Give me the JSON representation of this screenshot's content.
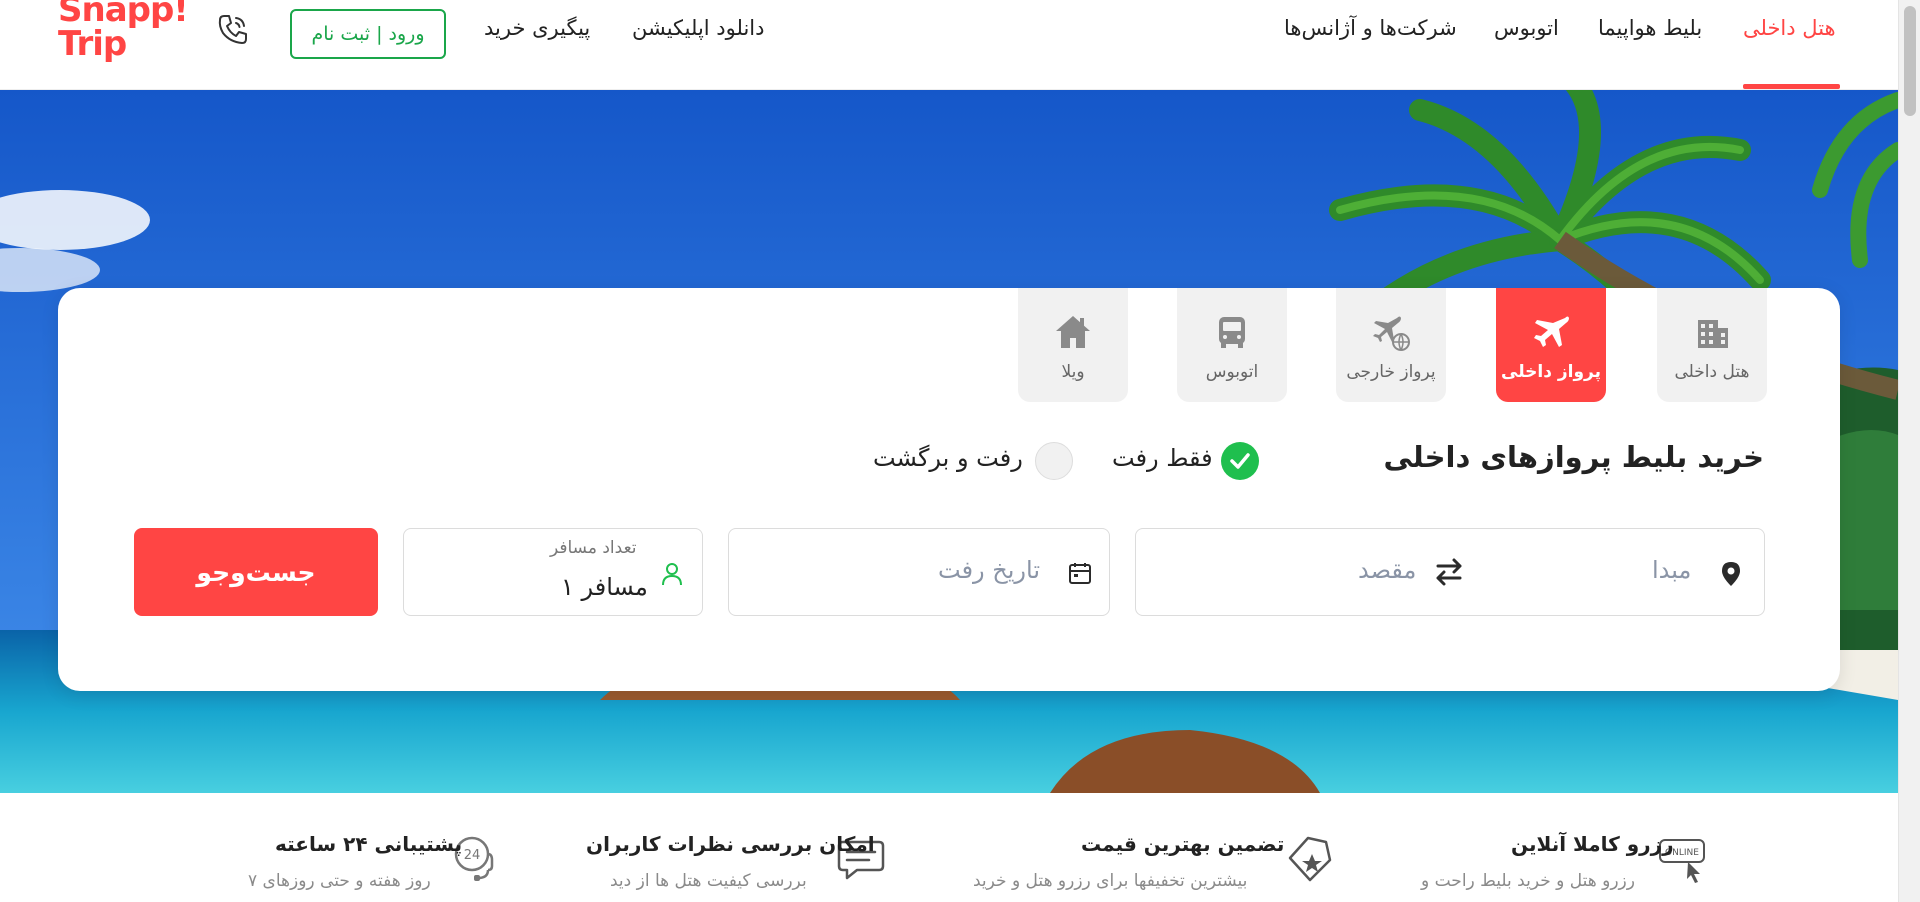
{
  "brand": {
    "logo_line1": "Snapp!",
    "logo_line2": "Trip",
    "accent_color": "#ff4544",
    "green_color": "#1aa64a"
  },
  "header": {
    "login_label": "ورود | ثبت نام",
    "phone_icon": "phone-icon",
    "nav": {
      "hotel": "هتل داخلی",
      "flight": "بلیط هواپیما",
      "bus": "اتوبوس",
      "agencies": "شرکت‌ها و آژانس‌ها",
      "download": "دانلود اپلیکیشن",
      "tracking": "پیگیری خرید"
    },
    "active_nav": "هتل داخلی"
  },
  "search": {
    "tabs": {
      "hotel": "هتل داخلی",
      "domestic_flight": "پرواز داخلی",
      "foreign_flight": "پرواز خارجی",
      "bus": "اتوبوس",
      "villa": "ویلا"
    },
    "active_tab": "پرواز داخلی",
    "title": "خرید بلیط پروازهای داخلی",
    "trip_types": {
      "one_way": "فقط رفت",
      "round_trip": "رفت و برگشت"
    },
    "selected_trip_type": "فقط رفت",
    "origin_placeholder": "مبدا",
    "destination_placeholder": "مقصد",
    "date_placeholder": "تاریخ رفت",
    "passengers_label": "تعداد مسافر",
    "passengers_value": "۱ مسافر",
    "submit_label": "جست‌وجو"
  },
  "features": {
    "online": {
      "title": "رزرو کاملا آنلاین",
      "desc": "رزرو هتل و خرید بلیط راحت و",
      "icon": "online-click-icon"
    },
    "price": {
      "title": "تضمین بهترین قیمت",
      "desc": "بیشترین تخفیفها برای رزرو هتل و خرید",
      "icon": "star-tag-icon"
    },
    "reviews": {
      "title": "امکان بررسی نظرات کاربران",
      "desc": "بررسی کیفیت هتل ها از دید",
      "icon": "chat-icon"
    },
    "support": {
      "title": "پشتیبانی ۲۴ ساعته",
      "desc": "۷ روز هفته و حتی روزهای",
      "icon": "support-24-icon"
    }
  }
}
